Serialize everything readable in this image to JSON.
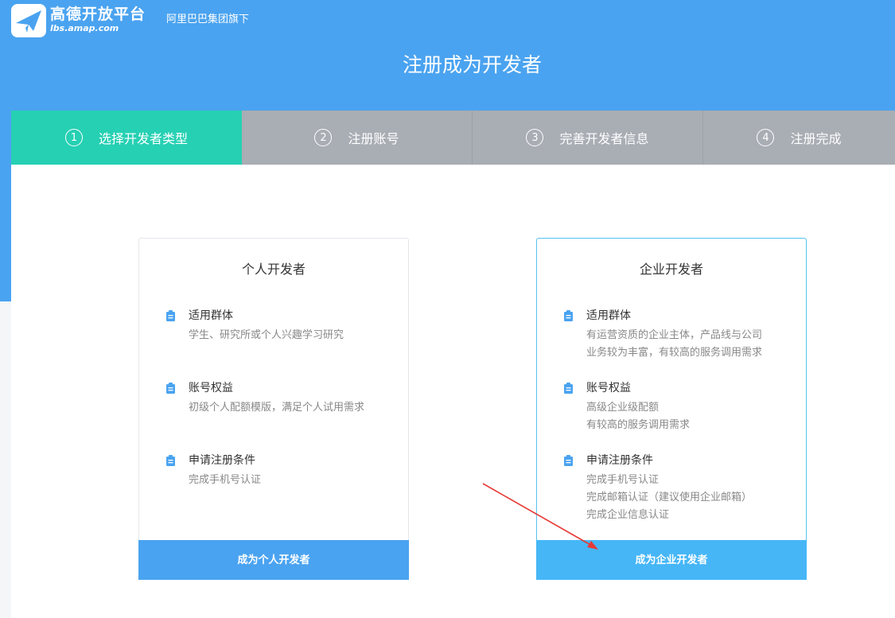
{
  "brand": {
    "name": "高德开放平台",
    "domain": "lbs.amap.com",
    "group": "阿里巴巴集团旗下",
    "logo_icon": "paper-plane-icon"
  },
  "page_title": "注册成为开发者",
  "colors": {
    "header": "#4aa3f0",
    "step_active": "#26d0b3",
    "step_inactive": "#a9adb4",
    "button": "#4aa3f0",
    "button_selected": "#46b6f7",
    "arrow": "#e53935"
  },
  "steps": [
    {
      "number": "1",
      "label": "选择开发者类型",
      "active": true
    },
    {
      "number": "2",
      "label": "注册账号",
      "active": false
    },
    {
      "number": "3",
      "label": "完善开发者信息",
      "active": false
    },
    {
      "number": "4",
      "label": "注册完成",
      "active": false
    }
  ],
  "cards": {
    "personal": {
      "title": "个人开发者",
      "sections": [
        {
          "icon": "clipboard-icon",
          "heading": "适用群体",
          "lines": [
            "学生、研究所或个人兴趣学习研究"
          ]
        },
        {
          "icon": "clipboard-icon",
          "heading": "账号权益",
          "lines": [
            "初级个人配额模版，满足个人试用需求"
          ]
        },
        {
          "icon": "clipboard-icon",
          "heading": "申请注册条件",
          "lines": [
            "完成手机号认证"
          ]
        }
      ],
      "button": "成为个人开发者"
    },
    "enterprise": {
      "title": "企业开发者",
      "sections": [
        {
          "icon": "clipboard-icon",
          "heading": "适用群体",
          "lines": [
            "有运营资质的企业主体，产品线与公司",
            "业务较为丰富，有较高的服务调用需求"
          ]
        },
        {
          "icon": "clipboard-icon",
          "heading": "账号权益",
          "lines": [
            "高级企业级配额",
            "有较高的服务调用需求"
          ]
        },
        {
          "icon": "clipboard-icon",
          "heading": "申请注册条件",
          "lines": [
            "完成手机号认证",
            "完成邮箱认证（建议使用企业邮箱）",
            "完成企业信息认证"
          ]
        }
      ],
      "button": "成为企业开发者"
    }
  }
}
